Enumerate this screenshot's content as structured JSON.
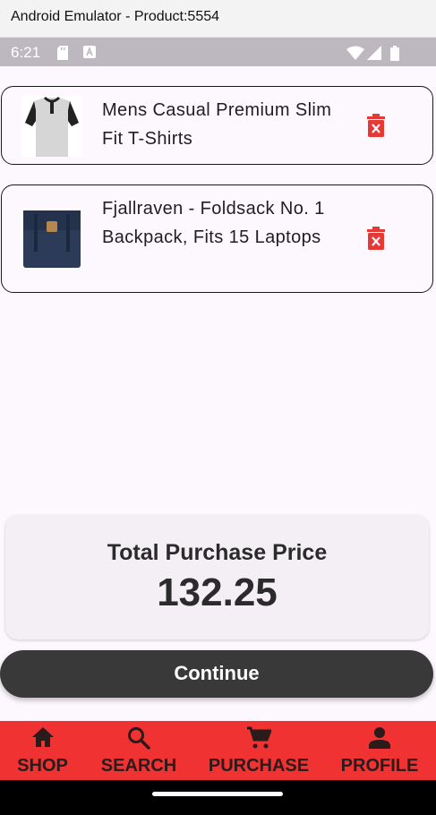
{
  "window": {
    "title": "Android Emulator - Product:5554"
  },
  "status_bar": {
    "time": "6:21",
    "icons": [
      "sd-card-icon",
      "notification-a-icon",
      "wifi-icon",
      "signal-icon",
      "battery-icon"
    ]
  },
  "cart": {
    "items": [
      {
        "name": "Mens Casual Premium Slim Fit T-Shirts",
        "image": "tshirt-image"
      },
      {
        "name": "Fjallraven - Foldsack No. 1 Backpack, Fits 15 Laptops",
        "image": "backpack-image"
      }
    ],
    "delete_icon": "trash-icon"
  },
  "total": {
    "label": "Total Purchase Price",
    "value": "132.25"
  },
  "continue_label": "Continue",
  "nav": {
    "items": [
      {
        "label": "SHOP",
        "icon": "home-icon"
      },
      {
        "label": "SEARCH",
        "icon": "search-icon"
      },
      {
        "label": "PURCHASE",
        "icon": "cart-icon"
      },
      {
        "label": "PROFILE",
        "icon": "person-icon"
      }
    ]
  },
  "colors": {
    "accent": "#f03232",
    "background": "#fdf7fe",
    "button": "#393939",
    "delete": "#e53935"
  }
}
